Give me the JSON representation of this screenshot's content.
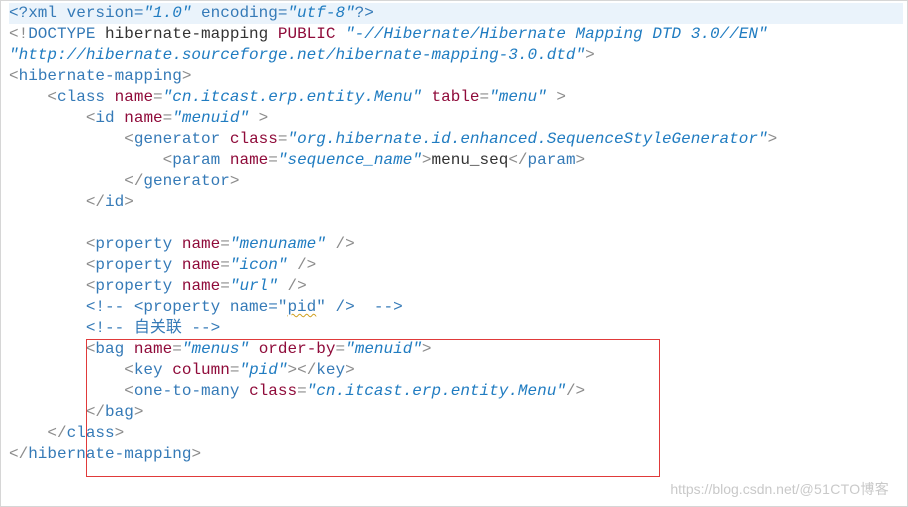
{
  "lines": {
    "l1": {
      "t1": "<?",
      "t2": "xml version=",
      "t3": "\"1.0\"",
      "t4": " encoding=",
      "t5": "\"utf-8\"",
      "t6": "?>"
    },
    "l2": {
      "t1": "<!",
      "t2": "DOCTYPE",
      "t3": " hibernate-mapping ",
      "t4": "PUBLIC",
      "t5": " ",
      "t6": "\"-//Hibernate/Hibernate Mapping DTD 3.0//EN\""
    },
    "l3": {
      "t1": "\"http://hibernate.sourceforge.net/hibernate-mapping-3.0.dtd\"",
      "t2": ">"
    },
    "l4": {
      "t1": "<",
      "t2": "hibernate-mapping",
      "t3": ">"
    },
    "l5": {
      "pad": "    ",
      "t1": "<",
      "t2": "class",
      "t3": " ",
      "t4": "name",
      "t5": "=",
      "t6": "\"cn.itcast.erp.entity.Menu\"",
      "t7": " ",
      "t8": "table",
      "t9": "=",
      "t10": "\"menu\"",
      "t11": " >"
    },
    "l6": {
      "pad": "        ",
      "t1": "<",
      "t2": "id",
      "t3": " ",
      "t4": "name",
      "t5": "=",
      "t6": "\"menuid\"",
      "t7": " >"
    },
    "l7": {
      "pad": "            ",
      "t1": "<",
      "t2": "generator",
      "t3": " ",
      "t4": "class",
      "t5": "=",
      "t6": "\"org.hibernate.id.enhanced.SequenceStyleGenerator\"",
      "t7": ">"
    },
    "l8": {
      "pad": "                ",
      "t1": "<",
      "t2": "param",
      "t3": " ",
      "t4": "name",
      "t5": "=",
      "t6": "\"sequence_name\"",
      "t7": ">",
      "t8": "menu_seq",
      "t9": "</",
      "t10": "param",
      "t11": ">"
    },
    "l9": {
      "pad": "            ",
      "t1": "</",
      "t2": "generator",
      "t3": ">"
    },
    "l10": {
      "pad": "        ",
      "t1": "</",
      "t2": "id",
      "t3": ">"
    },
    "l11": {
      "pad": ""
    },
    "l12": {
      "pad": "        ",
      "t1": "<",
      "t2": "property",
      "t3": " ",
      "t4": "name",
      "t5": "=",
      "t6": "\"menuname\"",
      "t7": " />"
    },
    "l13": {
      "pad": "        ",
      "t1": "<",
      "t2": "property",
      "t3": " ",
      "t4": "name",
      "t5": "=",
      "t6": "\"icon\"",
      "t7": " />"
    },
    "l14": {
      "pad": "        ",
      "t1": "<",
      "t2": "property",
      "t3": " ",
      "t4": "name",
      "t5": "=",
      "t6": "\"url\"",
      "t7": " />"
    },
    "l15": {
      "pad": "        ",
      "t1": "<!-- <property name=",
      "t2": "\"",
      "t3": "pid",
      "t4": "\"",
      "t5": " />  -->"
    },
    "l16": {
      "pad": "        ",
      "t1": "<!-- 自关联 -->"
    },
    "l17": {
      "pad": "        ",
      "t1": "<",
      "t2": "bag",
      "t3": " ",
      "t4": "name",
      "t5": "=",
      "t6": "\"menus\"",
      "t7": " ",
      "t8": "order-by",
      "t9": "=",
      "t10": "\"menuid\"",
      "t11": ">"
    },
    "l18": {
      "pad": "            ",
      "t1": "<",
      "t2": "key",
      "t3": " ",
      "t4": "column",
      "t5": "=",
      "t6": "\"pid\"",
      "t7": "></",
      "t8": "key",
      "t9": ">"
    },
    "l19": {
      "pad": "            ",
      "t1": "<",
      "t2": "one-to-many",
      "t3": " ",
      "t4": "class",
      "t5": "=",
      "t6": "\"cn.itcast.erp.entity.Menu\"",
      "t7": "/>"
    },
    "l20": {
      "pad": "        ",
      "t1": "</",
      "t2": "bag",
      "t3": ">"
    },
    "l21": {
      "pad": "    ",
      "t1": "</",
      "t2": "class",
      "t3": ">"
    },
    "l22": {
      "t1": "</",
      "t2": "hibernate-mapping",
      "t3": ">"
    }
  },
  "watermark": {
    "left": "https://blog.csdn.net/",
    "right": "@51CTO博客"
  }
}
